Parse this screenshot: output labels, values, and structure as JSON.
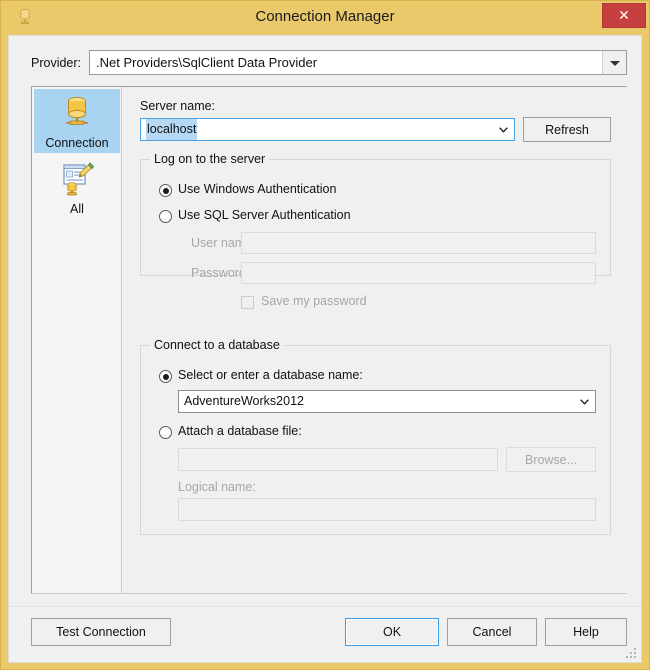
{
  "window": {
    "title": "Connection Manager",
    "title_icon": "database-icon",
    "close_label": "✕",
    "titlebar_color": "#eac96a",
    "close_color": "#c5403f"
  },
  "provider": {
    "label": "Provider:",
    "value": ".Net Providers\\SqlClient Data Provider",
    "icon": "chevron-down-icon"
  },
  "sidebar": {
    "items": [
      {
        "label": "Connection",
        "icon": "database-connection-icon",
        "selected": true
      },
      {
        "label": "All",
        "icon": "properties-page-icon",
        "selected": false
      }
    ],
    "selected_color": "#a8d4f2"
  },
  "server": {
    "label": "Server name:",
    "value": "localhost",
    "value_selected": true,
    "refresh_label": "Refresh"
  },
  "logon": {
    "title": "Log on to the server",
    "windows_auth_label": "Use Windows Authentication",
    "windows_auth_checked": true,
    "sql_auth_label": "Use SQL Server Authentication",
    "sql_auth_checked": false,
    "username_label": "User name:",
    "username_value": "",
    "password_label": "Password:",
    "password_value": "",
    "save_password_label": "Save my password",
    "save_password_checked": false
  },
  "database": {
    "title": "Connect to a database",
    "select_name_label": "Select or enter a database name:",
    "select_name_checked": true,
    "database_value": "AdventureWorks2012",
    "attach_file_label": "Attach a database file:",
    "attach_file_checked": false,
    "attach_file_value": "",
    "browse_label": "Browse...",
    "logical_name_label": "Logical name:",
    "logical_name_value": ""
  },
  "footer": {
    "test_connection_label": "Test Connection",
    "ok_label": "OK",
    "cancel_label": "Cancel",
    "help_label": "Help"
  }
}
